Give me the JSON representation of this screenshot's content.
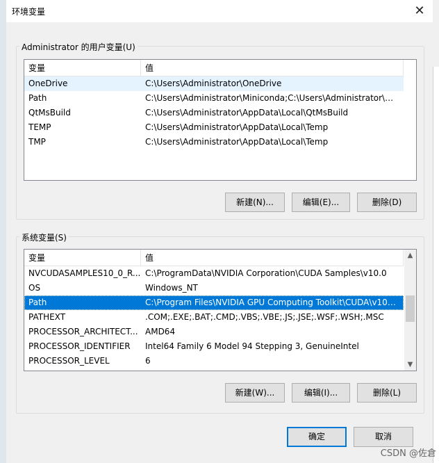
{
  "window": {
    "title": "环境变量",
    "close_icon": "close-icon"
  },
  "user_vars": {
    "group_label": "Administrator 的用户变量(U)",
    "columns": [
      "变量",
      "值"
    ],
    "rows": [
      {
        "name": "OneDrive",
        "value": "C:\\Users\\Administrator\\OneDrive"
      },
      {
        "name": "Path",
        "value": "C:\\Users\\Administrator\\Miniconda;C:\\Users\\Administrator\\Mi..."
      },
      {
        "name": "QtMsBuild",
        "value": "C:\\Users\\Administrator\\AppData\\Local\\QtMsBuild"
      },
      {
        "name": "TEMP",
        "value": "C:\\Users\\Administrator\\AppData\\Local\\Temp"
      },
      {
        "name": "TMP",
        "value": "C:\\Users\\Administrator\\AppData\\Local\\Temp"
      }
    ],
    "buttons": {
      "new": "新建(N)...",
      "edit": "编辑(E)...",
      "delete": "删除(D)"
    }
  },
  "sys_vars": {
    "group_label": "系统变量(S)",
    "columns": [
      "变量",
      "值"
    ],
    "rows": [
      {
        "name": "NVCUDASAMPLES10_0_R...",
        "value": "C:\\ProgramData\\NVIDIA Corporation\\CUDA Samples\\v10.0"
      },
      {
        "name": "OS",
        "value": "Windows_NT"
      },
      {
        "name": "Path",
        "value": "C:\\Program Files\\NVIDIA GPU Computing Toolkit\\CUDA\\v10...."
      },
      {
        "name": "PATHEXT",
        "value": ".COM;.EXE;.BAT;.CMD;.VBS;.VBE;.JS;.JSE;.WSF;.WSH;.MSC"
      },
      {
        "name": "PROCESSOR_ARCHITECT...",
        "value": "AMD64"
      },
      {
        "name": "PROCESSOR_IDENTIFIER",
        "value": "Intel64 Family 6 Model 94 Stepping 3, GenuineIntel"
      },
      {
        "name": "PROCESSOR_LEVEL",
        "value": "6"
      }
    ],
    "selected_row": 2,
    "buttons": {
      "new": "新建(W)...",
      "edit": "编辑(I)...",
      "delete": "删除(L)"
    }
  },
  "footer": {
    "ok": "确定",
    "cancel": "取消"
  },
  "watermark": "CSDN @佐倉",
  "colors": {
    "selection": "#0078d7",
    "hover": "#e5f3ff",
    "primary_border": "#0078d7"
  }
}
